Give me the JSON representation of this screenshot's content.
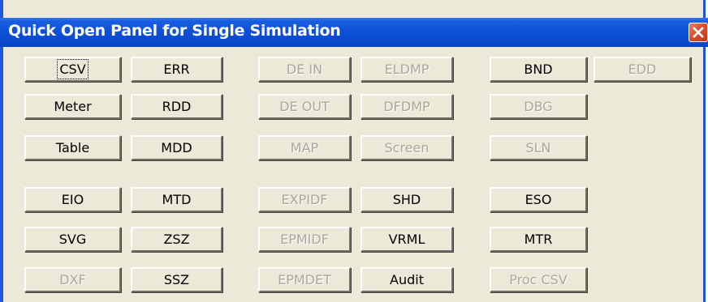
{
  "window": {
    "title": "Quick Open Panel for Single Simulation",
    "close_icon": "close-x-icon",
    "accent_color": "#0c4fd6",
    "close_color": "#d9502d"
  },
  "buttons": {
    "csv": "CSV",
    "err": "ERR",
    "de_in": "DE IN",
    "eldmp": "ELDMP",
    "bnd": "BND",
    "edd": "EDD",
    "meter": "Meter",
    "rdd": "RDD",
    "de_out": "DE OUT",
    "dfdmp": "DFDMP",
    "dbg": "DBG",
    "table": "Table",
    "mdd": "MDD",
    "map": "MAP",
    "screen": "Screen",
    "sln": "SLN",
    "eio": "EIO",
    "mtd": "MTD",
    "expidf": "EXPIDF",
    "shd": "SHD",
    "eso": "ESO",
    "svg": "SVG",
    "zsz": "ZSZ",
    "epmidf": "EPMIDF",
    "vrml": "VRML",
    "mtr": "MTR",
    "dxf": "DXF",
    "ssz": "SSZ",
    "epmdet": "EPMDET",
    "audit": "Audit",
    "proc_csv": "Proc CSV"
  }
}
